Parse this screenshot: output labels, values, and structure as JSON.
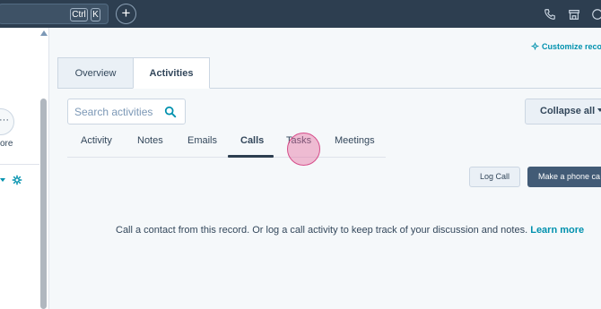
{
  "topbar": {
    "shortcut_ctrl": "Ctrl",
    "shortcut_k": "K",
    "new_label": "+"
  },
  "left_panel": {
    "more_button_icon": "ellipsis-icon",
    "more_label": "ore"
  },
  "record": {
    "customize_link": "Customize reco",
    "tabs": [
      {
        "label": "Overview",
        "active": false
      },
      {
        "label": "Activities",
        "active": true
      }
    ],
    "search": {
      "placeholder": "Search activities",
      "value": ""
    },
    "collapse_all": "Collapse all",
    "activity_tabs": [
      {
        "label": "Activity"
      },
      {
        "label": "Notes"
      },
      {
        "label": "Emails"
      },
      {
        "label": "Calls",
        "active": true
      },
      {
        "label": "Tasks"
      },
      {
        "label": "Meetings"
      }
    ],
    "log_call_button": "Log Call",
    "make_call_button": "Make a phone ca",
    "empty_message": "Call a contact from this record. Or log a call activity to keep track of your discussion and notes.",
    "learn_more": "Learn more"
  },
  "colors": {
    "topbar_bg": "#2d3e50",
    "accent_link": "#0091ae",
    "primary_button": "#425b76",
    "click_marker": "#e5669b"
  }
}
